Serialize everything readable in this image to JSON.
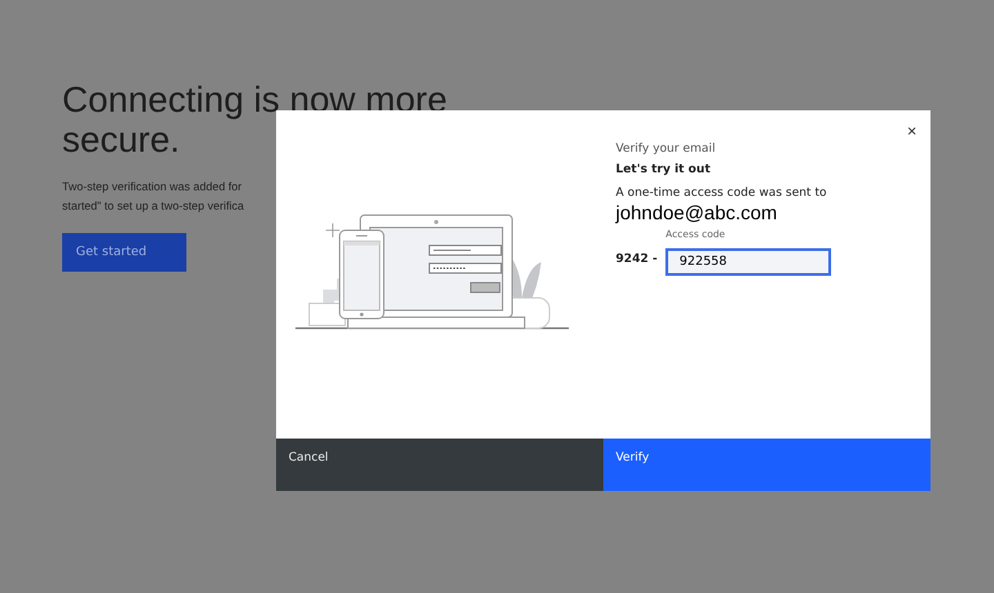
{
  "page": {
    "heading_lines": [
      "Connecting is now more",
      "secure."
    ],
    "body_lines": [
      "Two-step verification was added for",
      "started\" to set up a two-step verifica"
    ],
    "button": "Get started"
  },
  "dialog": {
    "close": "×",
    "title": "Verify your email",
    "subtitle": "Let's try it out",
    "message": "A one-time access code was sent to",
    "email": "johndoe@abc.com",
    "code_label": "Access code",
    "code_prefix": "9242 -",
    "code_value": "922558",
    "buttons": [
      {
        "label": "Cancel",
        "kind": "secondary"
      },
      {
        "label": "Verify",
        "kind": "primary"
      }
    ]
  }
}
